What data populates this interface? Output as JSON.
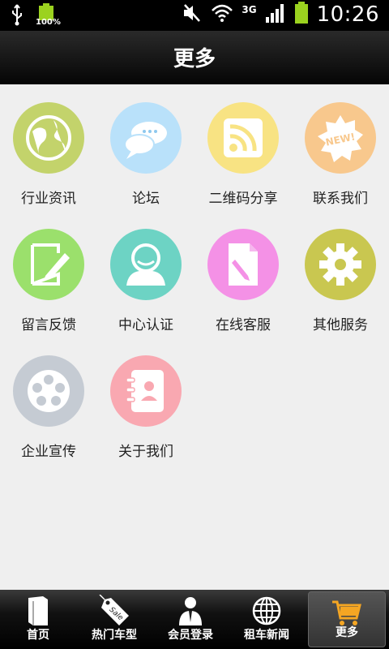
{
  "status_bar": {
    "battery_percent": "100%",
    "network": "3G",
    "time": "10:26"
  },
  "header": {
    "title": "更多"
  },
  "grid": {
    "items": [
      {
        "label": "行业资讯",
        "icon": "globe-icon",
        "color": "#c3d36b"
      },
      {
        "label": "论坛",
        "icon": "chat-bubble-icon",
        "color": "#b9e1fa"
      },
      {
        "label": "二维码分享",
        "icon": "rss-icon",
        "color": "#f8e383"
      },
      {
        "label": "联系我们",
        "icon": "new-badge-icon",
        "color": "#f8c88d"
      },
      {
        "label": "留言反馈",
        "icon": "edit-note-icon",
        "color": "#9be06c"
      },
      {
        "label": "中心认证",
        "icon": "user-icon",
        "color": "#6dd3c4"
      },
      {
        "label": "在线客服",
        "icon": "document-pen-icon",
        "color": "#f491e6"
      },
      {
        "label": "其他服务",
        "icon": "gear-icon",
        "color": "#c9c750"
      },
      {
        "label": "企业宣传",
        "icon": "film-reel-icon",
        "color": "#c5cbd3"
      },
      {
        "label": "关于我们",
        "icon": "contact-book-icon",
        "color": "#f9a8b1"
      }
    ]
  },
  "tab_bar": {
    "tabs": [
      {
        "label": "首页",
        "icon": "book-icon",
        "active": false
      },
      {
        "label": "热门车型",
        "icon": "sale-tag-icon",
        "active": false
      },
      {
        "label": "会员登录",
        "icon": "member-icon",
        "active": false
      },
      {
        "label": "租车新闻",
        "icon": "globe-icon",
        "active": false
      },
      {
        "label": "更多",
        "icon": "cart-icon",
        "active": true
      }
    ]
  }
}
